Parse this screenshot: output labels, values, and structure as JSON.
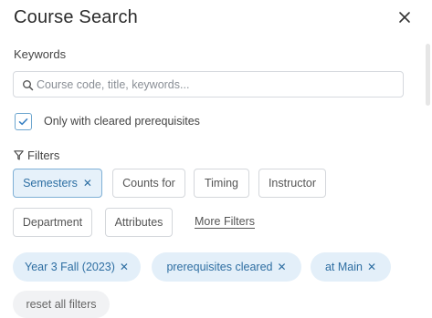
{
  "panel": {
    "title": "Course Search",
    "close_icon": "close-icon"
  },
  "keywords": {
    "label": "Keywords",
    "value": "",
    "placeholder": "Course code, title, keywords..."
  },
  "prerequisites": {
    "checked": true,
    "label": "Only with cleared prerequisites"
  },
  "filters": {
    "label": "Filters",
    "icon": "funnel-icon",
    "buttons": [
      {
        "label": "Semesters",
        "active": true,
        "has_remove": true
      },
      {
        "label": "Counts for",
        "active": false
      },
      {
        "label": "Timing",
        "active": false
      },
      {
        "label": "Instructor",
        "active": false
      },
      {
        "label": "Department",
        "active": false
      },
      {
        "label": "Attributes",
        "active": false
      }
    ],
    "more_label": "More Filters"
  },
  "active_filters": [
    {
      "label": "Year 3 Fall (2023)"
    },
    {
      "label": "prerequisites cleared"
    },
    {
      "label": "at Main"
    }
  ],
  "remove_glyph": "✕",
  "reset_label": "reset all filters",
  "colors": {
    "accent": "#2d6fa3",
    "active_bg": "#e6f1fa",
    "pill_bg": "#e3eff9",
    "border": "#d4d7db"
  }
}
